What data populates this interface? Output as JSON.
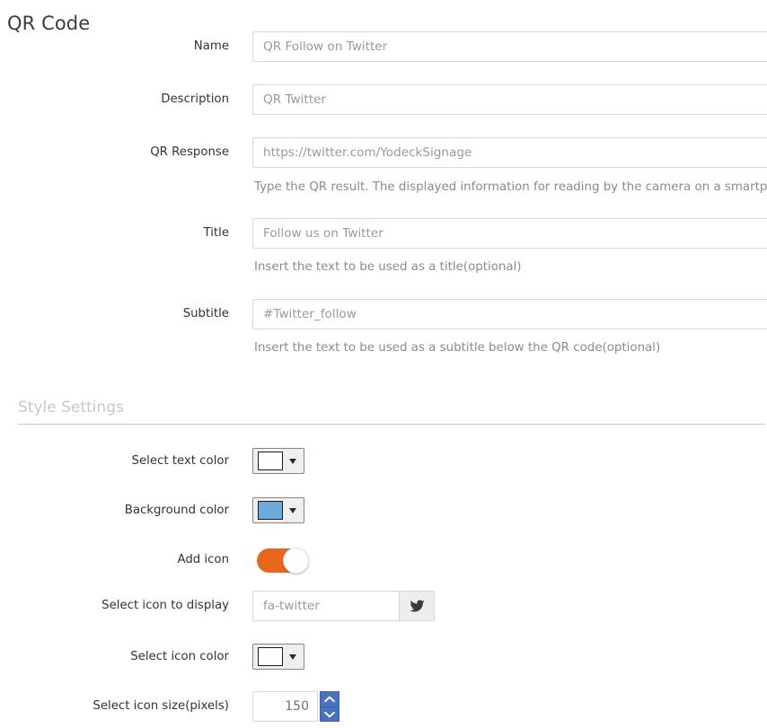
{
  "page": {
    "title": "QR Code",
    "title_color": "#3b3b3b",
    "background": "#ffffff"
  },
  "form": {
    "fields": [
      {
        "label": "Name",
        "name": "name",
        "value": "QR Follow on Twitter",
        "placeholder": "QR Follow on Twitter",
        "help": ""
      },
      {
        "label": "Description",
        "name": "description",
        "value": "QR Twitter",
        "placeholder": "QR Twitter",
        "help": ""
      },
      {
        "label": "QR Response",
        "name": "qr-response",
        "value": "https://twitter.com/YodeckSignage",
        "placeholder": "https://twitter.com/YodeckSignage",
        "help": "Type the QR result. The displayed information for reading by the camera on a smartphone"
      },
      {
        "label": "Title",
        "name": "title",
        "value": "Follow us on Twitter",
        "placeholder": "Follow us on Twitter",
        "help": "Insert the text to be used as a title(optional)"
      },
      {
        "label": "Subtitle",
        "name": "subtitle",
        "value": "#Twitter_follow",
        "placeholder": "#Twitter_follow",
        "help": "Insert the text to be used as a subtitle below the QR code(optional)"
      }
    ]
  },
  "style_settings": {
    "section_title": "Style Settings",
    "section_title_color": "#c9c6d0",
    "text_color": {
      "label": "Select text color",
      "swatch_hex": "#ffffff",
      "picker_border": "#9e7f69",
      "caret_icon": "caret-down-icon"
    },
    "background_color": {
      "label": "Background color",
      "swatch_hex": "#6fa8dc",
      "picker_border": "#9e7f69",
      "caret_icon": "caret-down-icon"
    },
    "add_icon": {
      "label": "Add icon",
      "state": "on",
      "track_hex": "#e8671c",
      "knob_hex": "#ffffff"
    },
    "icon_to_display": {
      "label": "Select icon to display",
      "value": "fa-twitter",
      "placeholder": "fa-twitter",
      "addon_icon": "twitter-bird-icon"
    },
    "icon_color": {
      "label": "Select icon color",
      "swatch_hex": "#ffffff",
      "picker_border": "#9e7f69",
      "caret_icon": "caret-down-icon"
    },
    "icon_size": {
      "label": "Select icon size(pixels)",
      "value": "150",
      "up_icon": "chevron-up-icon",
      "down_icon": "chevron-down-icon",
      "spin_button_hex": "#4a72b8"
    }
  }
}
